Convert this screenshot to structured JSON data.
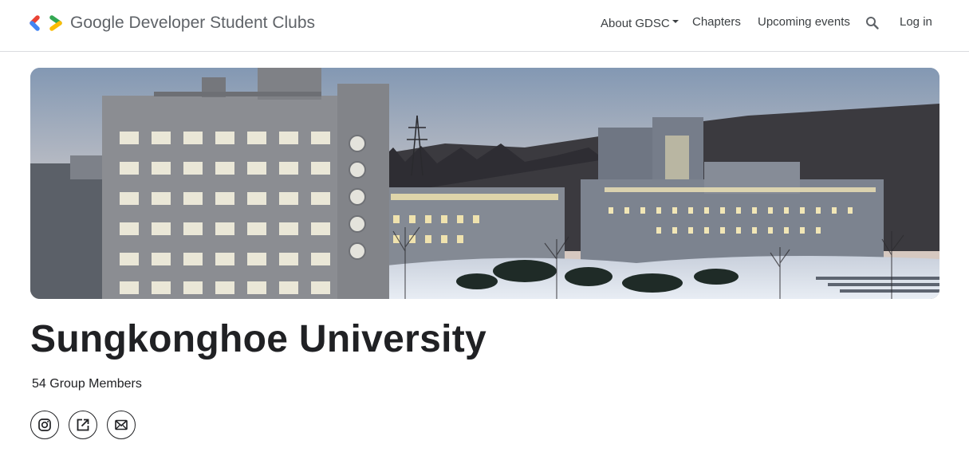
{
  "header": {
    "brand_name": "Google Developer Student Clubs",
    "logo_icon": "gdsc-logo-icon",
    "nav": {
      "about": "About GDSC",
      "chapters": "Chapters",
      "upcoming_events": "Upcoming events",
      "search_icon": "search-icon",
      "login": "Log in"
    }
  },
  "hero": {
    "image": "campus-banner-image"
  },
  "chapter": {
    "title": "Sungkonghoe University",
    "members": "54 Group Members"
  },
  "social_links": [
    {
      "icon": "instagram-icon"
    },
    {
      "icon": "external-link-icon"
    },
    {
      "icon": "email-icon"
    }
  ],
  "colors": {
    "logo_red": "#ea4335",
    "logo_blue": "#4285f4",
    "logo_green": "#34a853",
    "logo_yellow": "#fbbc04",
    "text_primary": "#202124",
    "text_secondary": "#5f6368"
  }
}
